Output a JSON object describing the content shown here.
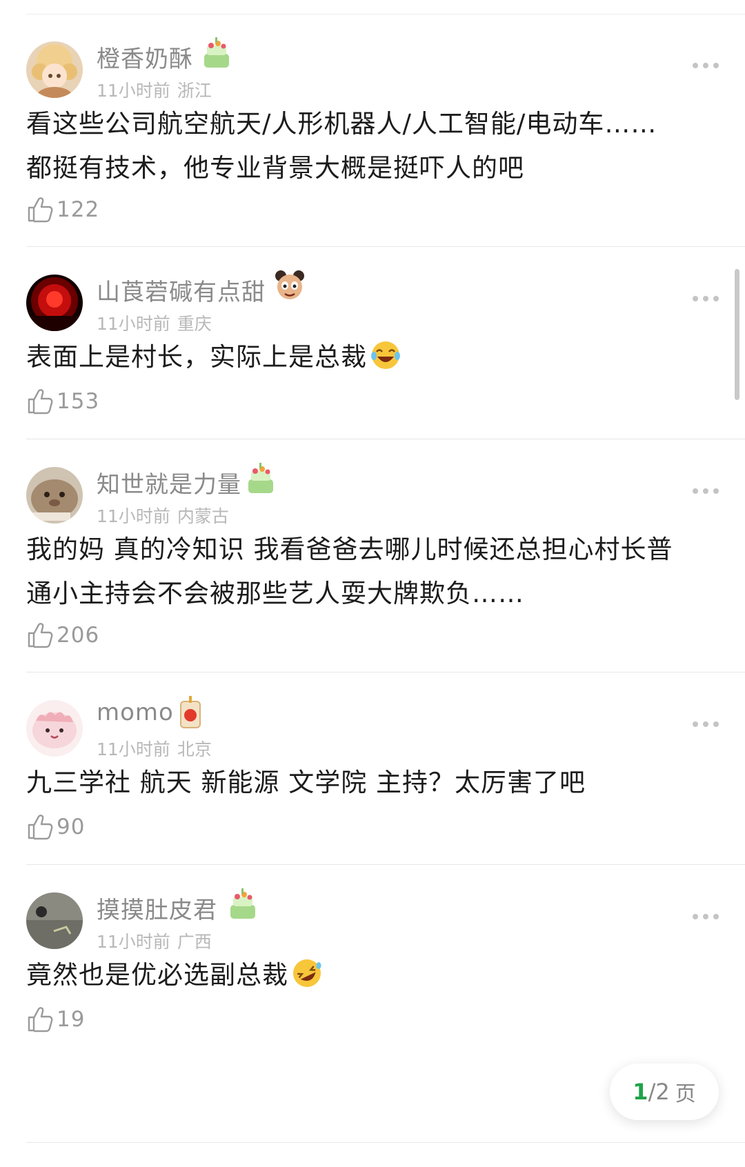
{
  "comments": [
    {
      "username": "橙香奶酥",
      "time": "11小时前",
      "location": "浙江",
      "text_lines": [
        "看这些公司航空航天/人形机器人/人工智能/电动车……",
        "都挺有技术，他专业背景大概是挺吓人的吧"
      ],
      "likes": "122",
      "badge": "cake-badge-icon",
      "avatar": "cartoon-girl-avatar"
    },
    {
      "username": "山莨菪碱有点甜",
      "time": "11小时前",
      "location": "重庆",
      "text_lines": [
        "表面上是村长，实际上是总裁"
      ],
      "likes": "153",
      "badge": "cartoon-character-badge-icon",
      "avatar": "red-light-avatar",
      "emoji": "laughing-tears-emoji"
    },
    {
      "username": "知世就是力量",
      "time": "11小时前",
      "location": "内蒙古",
      "text_lines": [
        "我的妈 真的冷知识 我看爸爸去哪儿时候还总担心村长普",
        "通小主持会不会被那些艺人耍大牌欺负……"
      ],
      "likes": "206",
      "badge": "cake-badge-icon",
      "avatar": "hamster-meme-avatar"
    },
    {
      "username": "momo",
      "time": "11小时前",
      "location": "北京",
      "text_lines": [
        "九三学社 航天 新能源 文学院 主持？太厉害了吧"
      ],
      "likes": "90",
      "badge": "lucky-amulet-badge-icon",
      "avatar": "pink-blob-avatar"
    },
    {
      "username": "摸摸肚皮君",
      "time": "11小时前",
      "location": "广西",
      "text_lines": [
        "竟然也是优必选副总裁"
      ],
      "likes": "19",
      "badge": "cake-badge-icon",
      "avatar": "cat-photo-avatar",
      "emoji": "rofl-emoji"
    }
  ],
  "pager": {
    "current": "1",
    "separator": "/",
    "total": "2",
    "unit": "页"
  },
  "colors": {
    "accent_green": "#20a34a",
    "muted": "#8a8a8a",
    "text": "#1c1c1c"
  }
}
